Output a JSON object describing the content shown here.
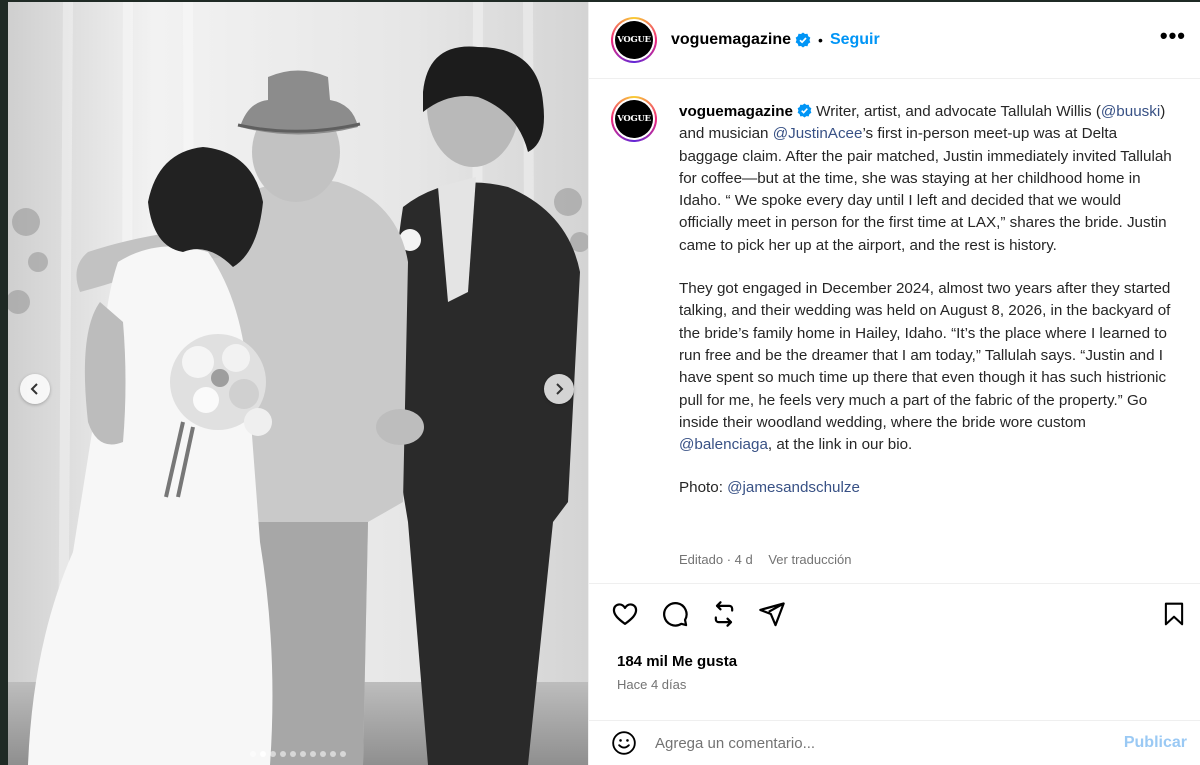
{
  "post": {
    "username": "voguemagazine",
    "avatar_text": "VOGUE",
    "separator": "•",
    "follow_label": "Seguir",
    "more_label": "•••",
    "verified_icon": "verified-badge-icon",
    "accent_color": "#0095f6"
  },
  "caption": {
    "username": "voguemagazine",
    "p1_a": " Writer, artist, and advocate Tallulah Willis (",
    "mention_1": "@buuski",
    "p1_b": ") and musician ",
    "mention_2": "@JustinAcee",
    "p1_c": "’s first in-person meet-up was at Delta baggage claim. After the pair matched, Justin immediately invited Tallulah for coffee—but at the time, she was staying at her childhood home in Idaho. “ We spoke every day until I left and decided that we would officially meet in person for the first time at LAX,” shares the bride. Justin came to pick her up at the airport, and the rest is history.",
    "p2_a": "They got engaged in December 2024, almost two years after they started talking, and their wedding was held on August 8, 2026, in the backyard of the bride’s family home in Hailey, Idaho. “It’s the place where I learned to run free and be the dreamer that I am today,” Tallulah says. “Justin and I have spent so much time up there that even though it has such histrionic pull for me, he feels very much a part of the fabric of the property.” Go inside their woodland wedding, where the bride wore custom ",
    "mention_3": "@balenciaga",
    "p2_b": ", at the link in our bio.",
    "photo_label": "Photo: ",
    "mention_4": "@jamesandschulze",
    "edited": "Editado · 4 d",
    "translate": "Ver traducción"
  },
  "stats": {
    "likes": "184 mil Me gusta",
    "time": "Hace 4 días"
  },
  "comment": {
    "placeholder": "Agrega un comentario...",
    "publish_label": "Publicar"
  },
  "carousel": {
    "slide_count": 10,
    "active_index": 1
  }
}
